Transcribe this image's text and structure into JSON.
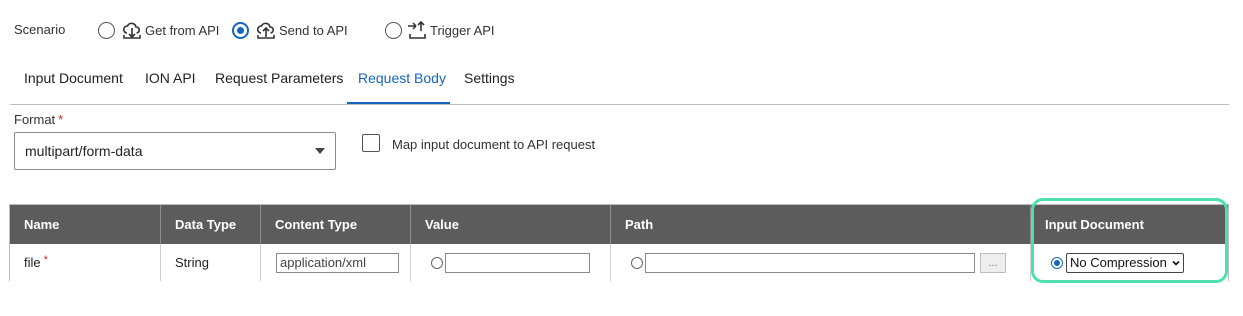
{
  "scenario": {
    "label": "Scenario",
    "options": [
      {
        "label": "Get from API",
        "icon": "cloud-download-icon",
        "selected": false
      },
      {
        "label": "Send to API",
        "icon": "cloud-upload-icon",
        "selected": true
      },
      {
        "label": "Trigger API",
        "icon": "trigger-api-icon",
        "selected": false
      }
    ]
  },
  "tabs": [
    {
      "label": "Input Document",
      "active": false
    },
    {
      "label": "ION API",
      "active": false
    },
    {
      "label": "Request Parameters",
      "active": false
    },
    {
      "label": "Request Body",
      "active": true
    },
    {
      "label": "Settings",
      "active": false
    }
  ],
  "format": {
    "label": "Format",
    "required_mark": "*",
    "value": "multipart/form-data",
    "map_checkbox_label": "Map input document to API request",
    "map_checked": false
  },
  "table": {
    "headers": [
      "Name",
      "Data Type",
      "Content Type",
      "Value",
      "Path",
      "Input Document"
    ],
    "row": {
      "name": "file",
      "required_mark": "*",
      "data_type": "String",
      "content_type": "application/xml",
      "value": "",
      "path": "",
      "browse_label": "...",
      "input_document_option": "No Compression",
      "input_document_selected": true
    }
  },
  "colors": {
    "accent": "#1565c0",
    "header_bg": "#5c5c5c",
    "highlight": "#4de0ad",
    "required": "#c62828"
  }
}
